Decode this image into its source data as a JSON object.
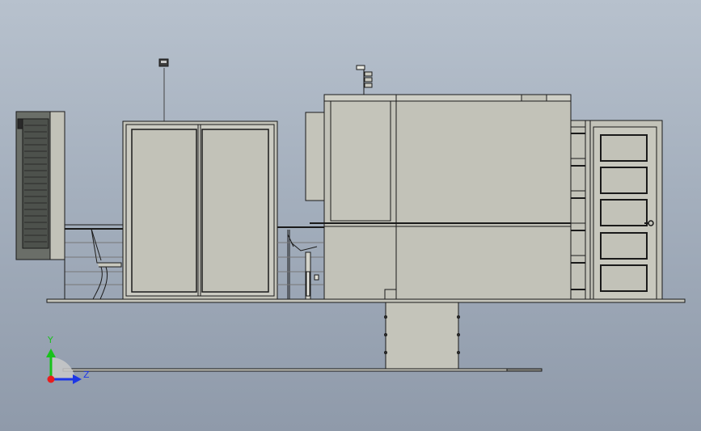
{
  "triad": {
    "y_label": "Y",
    "z_label": "Z",
    "y_color": "#19c21b",
    "z_color": "#1d37e6",
    "x_color": "#e81d1d"
  },
  "colors": {
    "background_top": "#b7c1cd",
    "background_bottom": "#8f9aaa",
    "body_fill": "#c2c2b8",
    "panel_fill": "#cbcbc2",
    "outline": "#1a1a1a",
    "vent_fill": "#4d514c"
  }
}
